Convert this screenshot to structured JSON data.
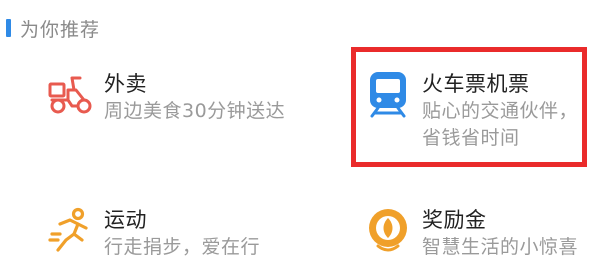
{
  "section": {
    "title": "为你推荐"
  },
  "cards": [
    {
      "title": "外卖",
      "desc": "周边美食30分钟送达",
      "icon": "scooter-delivery-icon",
      "color": "#e85a4f"
    },
    {
      "title": "火车票机票",
      "desc": "贴心的交通伙伴，省钱省时间",
      "icon": "train-icon",
      "color": "#2f8ae6"
    },
    {
      "title": "运动",
      "desc": "行走捐步，爱在行",
      "icon": "running-person-icon",
      "color": "#f0a02a"
    },
    {
      "title": "奖励金",
      "desc": "智慧生活的小惊喜",
      "icon": "reward-coin-icon",
      "color": "#f0a02a"
    }
  ],
  "colors": {
    "header_accent": "#2f8ae6",
    "highlight": "#ea2b2b"
  }
}
